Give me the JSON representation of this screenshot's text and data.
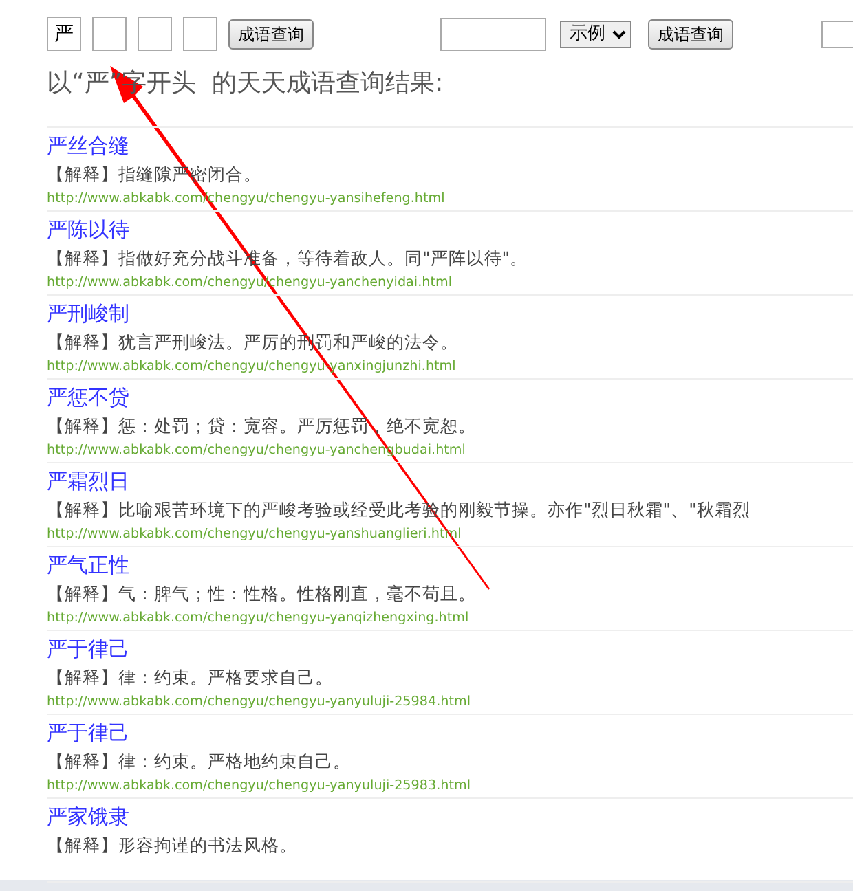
{
  "search": {
    "char_boxes": [
      {
        "value": "严"
      }
    ],
    "button": "成语查询",
    "select": {
      "value": "示例"
    },
    "button_2": "成语查询"
  },
  "heading": "以“严”字开头  的天天成语查询结果:",
  "results": [
    {
      "title": "严丝合缝",
      "explanation": "【解释】指缝隙严密闭合。",
      "url": "http://www.abkabk.com/chengyu/chengyu-yansihefeng.html"
    },
    {
      "title": "严陈以待",
      "explanation": "【解释】指做好充分战斗准备，等待着敌人。同\"严阵以待\"。",
      "url": "http://www.abkabk.com/chengyu/chengyu-yanchenyidai.html"
    },
    {
      "title": "严刑峻制",
      "explanation": "【解释】犹言严刑峻法。严厉的刑罚和严峻的法令。",
      "url": "http://www.abkabk.com/chengyu/chengyu-yanxingjunzhi.html"
    },
    {
      "title": "严惩不贷",
      "explanation": "【解释】惩：处罚；贷：宽容。严厉惩罚，绝不宽恕。",
      "url": "http://www.abkabk.com/chengyu/chengyu-yanchengbudai.html"
    },
    {
      "title": "严霜烈日",
      "explanation": "【解释】比喻艰苦环境下的严峻考验或经受此考验的刚毅节操。亦作\"烈日秋霜\"、\"秋霜烈",
      "url": "http://www.abkabk.com/chengyu/chengyu-yanshuanglieri.html"
    },
    {
      "title": "严气正性",
      "explanation": "【解释】气：脾气；性：性格。性格刚直，毫不苟且。",
      "url": "http://www.abkabk.com/chengyu/chengyu-yanqizhengxing.html"
    },
    {
      "title": "严于律己",
      "explanation": "【解释】律：约束。严格要求自己。",
      "url": "http://www.abkabk.com/chengyu/chengyu-yanyuluji-25984.html"
    },
    {
      "title": "严于律己",
      "explanation": "【解释】律：约束。严格地约束自己。",
      "url": "http://www.abkabk.com/chengyu/chengyu-yanyuluji-25983.html"
    },
    {
      "title": "严家饿隶",
      "explanation": "【解释】形容拘谨的书法风格。"
    }
  ],
  "annotation": {
    "kind": "arrow",
    "color": "#ff0000"
  }
}
